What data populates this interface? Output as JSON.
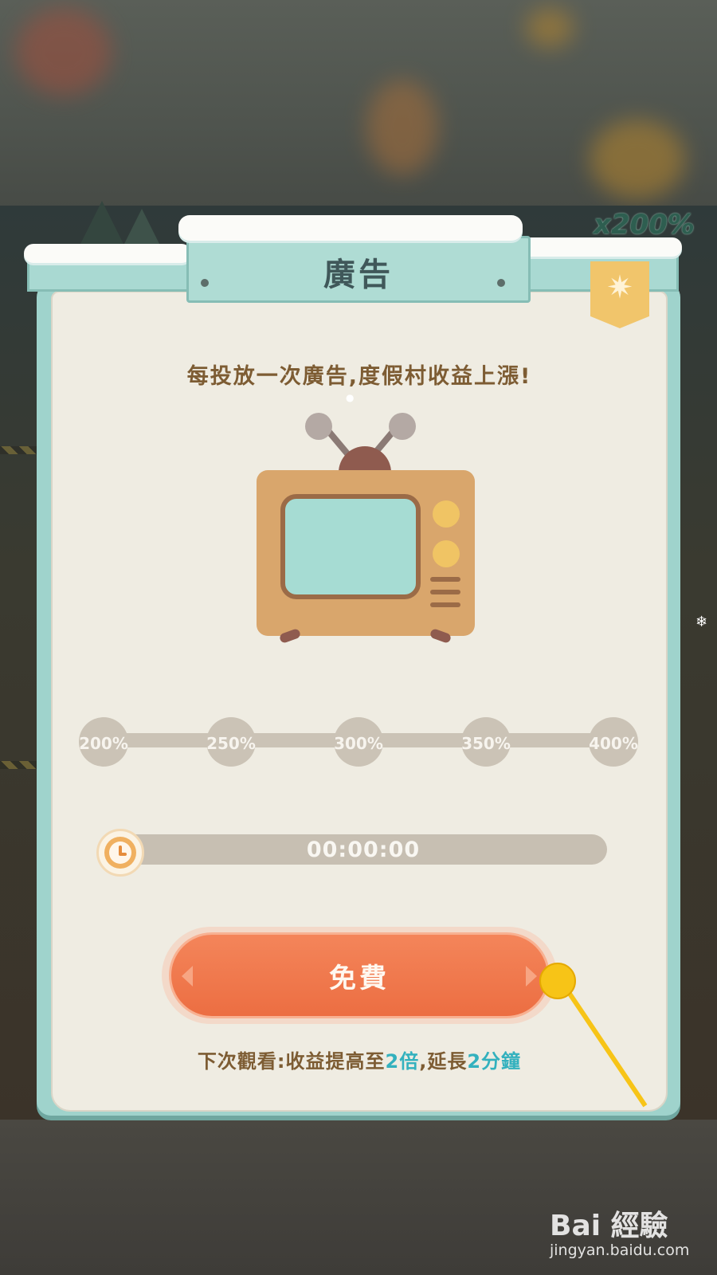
{
  "background": {
    "multiplier_label": "x200%"
  },
  "dialog": {
    "title": "廣告",
    "subtitle": "每投放一次廣告,度假村收益上漲!",
    "steps": [
      "200%",
      "250%",
      "300%",
      "350%",
      "400%"
    ],
    "timer": "00:00:00",
    "button_label": "免費",
    "footnote": {
      "prefix": "下次觀看:收益提高至",
      "multiplier": "2倍",
      "middle": ",延長",
      "duration": "2分鐘"
    }
  },
  "watermark": {
    "logo": "Bai 經驗",
    "url": "jingyan.baidu.com"
  },
  "colors": {
    "accent_orange": "#ec6e42",
    "highlight_teal": "#33b1be",
    "text_brown": "#7d5c33",
    "panel_teal": "#9fd3cc"
  },
  "icons": {
    "badge": "snowflake-emblem-icon",
    "timer": "clock-icon",
    "hero": "television-icon"
  }
}
